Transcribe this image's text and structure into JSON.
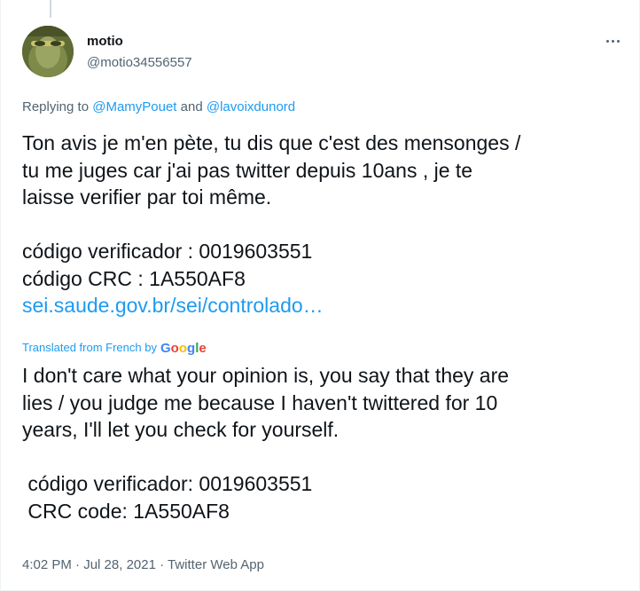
{
  "author": {
    "name": "motio",
    "handle": "@motio34556557"
  },
  "reply": {
    "prefix": "Replying to ",
    "to_1": "@MamyPouet",
    "and": " and ",
    "to_2": "@lavoixdunord"
  },
  "tweet": {
    "lines": [
      "Ton avis je m'en pète, tu dis que c'est des mensonges /",
      "tu me juges car j'ai pas twitter depuis 10ans , je te",
      "laisse verifier par toi même.",
      "código verificador : 0019603551",
      "código CRC : 1A550AF8"
    ],
    "link": "sei.saude.gov.br/sei/controlado…"
  },
  "translation": {
    "label": "Translated from French by",
    "provider": "Google",
    "lines": [
      "I don't care what your opinion is, you say that they are",
      "lies / you judge me because I haven't twittered for 10",
      "years, I'll let you check for yourself.",
      " código verificador: 0019603551",
      " CRC code: 1A550AF8"
    ]
  },
  "meta": {
    "time": "4:02 PM",
    "sep1": " · ",
    "date": "Jul 28, 2021",
    "sep2": " · ",
    "source": "Twitter Web App"
  },
  "icons": {
    "more": "more-options-icon",
    "avatar": "avatar"
  }
}
